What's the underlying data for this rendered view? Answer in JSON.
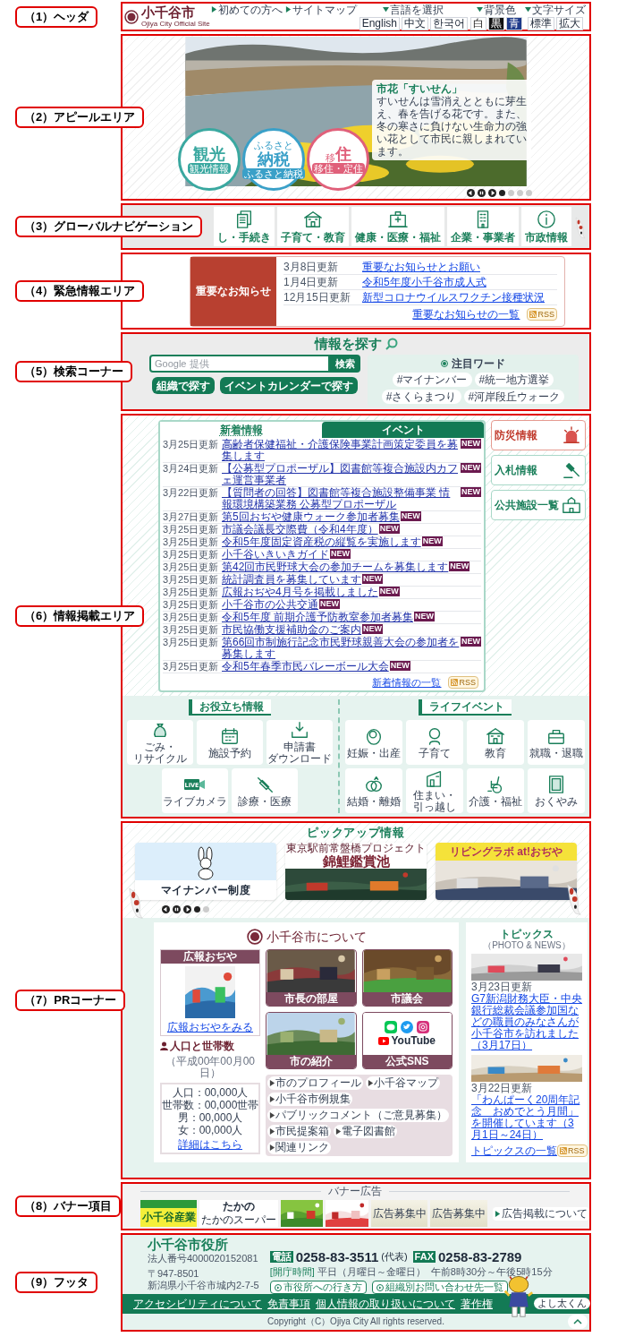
{
  "labels": [
    "（1）ヘッダ",
    "（2）アピールエリア",
    "（3）グローバルナビゲーション",
    "（4）緊急情報エリア",
    "（5）検索コーナー",
    "（6）情報掲載エリア",
    "（7）PRコーナー",
    "（8）バナー項目",
    "（9）フッタ"
  ],
  "header": {
    "logo": "小千谷市",
    "subtitle": "Ojiya City Official Site",
    "links": [
      "初めての方へ",
      "サイトマップ"
    ],
    "language": {
      "label": "言語を選択",
      "options": [
        "English",
        "中文",
        "한국어"
      ]
    },
    "background": {
      "label": "背景色",
      "options": [
        {
          "label": "白",
          "color": "#ffffff"
        },
        {
          "label": "黒",
          "color": "#111111"
        },
        {
          "label": "青",
          "color": "#1e3a8a"
        }
      ]
    },
    "font_size": {
      "label": "文字サイズ",
      "options": [
        "標準",
        "拡大"
      ]
    }
  },
  "appeal": {
    "caption_title": "市花「すいせん」",
    "caption_text": "すいせんは雪消えとともに芽生え、春を告げる花です。また、冬の寒さに負けない生命力の強い花として市民に親しまれています。",
    "badges": [
      {
        "title": "観光",
        "sub": "観光情報",
        "color": "#3aa8a0"
      },
      {
        "kicker": "ふるさと",
        "title": "納税",
        "sub": "ふるさと納税",
        "color": "#3aa0c8"
      },
      {
        "kicker": "移",
        "title": "住",
        "sub": "移住・定住",
        "color": "#e0607a"
      }
    ],
    "slides": [
      {
        "selected": true
      },
      {
        "selected": false
      },
      {
        "selected": false
      },
      {
        "selected": false
      }
    ]
  },
  "nav": {
    "items": [
      "し・手続き",
      "子育て・教育",
      "健康・医療・福祉",
      "企業・事業者",
      "市政情報"
    ]
  },
  "emergency": {
    "heading": "重要なお知らせ",
    "items": [
      {
        "date": "3月8日更新",
        "title": "重要なお知らせとお願い"
      },
      {
        "date": "1月4日更新",
        "title": "令和5年度小千谷市成人式"
      },
      {
        "date": "12月15日更新",
        "title": "新型コロナウイルスワクチン接種状況"
      }
    ],
    "more": "重要なお知らせの一覧",
    "rss": "RSS"
  },
  "search": {
    "title": "情報を探す",
    "placeholder": "Google 提供",
    "button": "検索",
    "buttons": [
      "組織で探す",
      "イベントカレンダーで探す"
    ],
    "keywords_title": "注目ワード",
    "keywords": [
      "#マイナンバー",
      "#統一地方選挙",
      "#さくらまつり",
      "#河岸段丘ウォーク"
    ]
  },
  "info": {
    "tabs": [
      {
        "label": "新着情報",
        "selected": true
      },
      {
        "label": "イベント",
        "selected": false
      }
    ],
    "news": [
      {
        "date": "3月25日更新",
        "title": "高齢者保健福祉・介護保険事業計画策定委員を募集します",
        "badge": "NEW"
      },
      {
        "date": "3月24日更新",
        "title": "【公募型プロポーザル】図書館等複合施設内カフェ運営事業者",
        "badge": "NEW"
      },
      {
        "date": "3月22日更新",
        "title": "【質問者の回答】図書館等複合施設整備事業 情報環境構築業務 公募型プロポーザル",
        "badge": "NEW"
      },
      {
        "date": "3月27日更新",
        "title": "第5回おぢや健康ウォーク参加者募集",
        "badge": "NEW"
      },
      {
        "date": "3月25日更新",
        "title": "市議会議長交際費（令和4年度）",
        "badge": "NEW"
      },
      {
        "date": "3月25日更新",
        "title": "令和5年度固定資産税の縦覧を実施します",
        "badge": "NEW"
      },
      {
        "date": "3月25日更新",
        "title": "小千谷いきいきガイド",
        "badge": "NEW"
      },
      {
        "date": "3月25日更新",
        "title": "第42回市民野球大会の参加チームを募集します",
        "badge": "NEW"
      },
      {
        "date": "3月25日更新",
        "title": "統計調査員を募集しています",
        "badge": "NEW"
      },
      {
        "date": "3月25日更新",
        "title": "広報おぢや4月号を掲載しました",
        "badge": "NEW"
      },
      {
        "date": "3月25日更新",
        "title": "小千谷市の公共交通",
        "badge": "NEW"
      },
      {
        "date": "3月25日更新",
        "title": "令和5年度 前期介護予防教室参加者募集",
        "badge": "NEW"
      },
      {
        "date": "3月25日更新",
        "title": "市民協働支援補助金のご案内",
        "badge": "NEW"
      },
      {
        "date": "3月25日更新",
        "title": "第66回市制施行記念市民野球親善大会の参加者を募集します",
        "badge": "NEW"
      },
      {
        "date": "3月25日更新",
        "title": "令和5年春季市民バレーボール大会",
        "badge": "NEW"
      }
    ],
    "more": "新着情報の一覧",
    "rss": "RSS",
    "side": [
      {
        "label": "防災情報",
        "kind": "alert"
      },
      {
        "label": "入札情報",
        "kind": "normal"
      },
      {
        "label": "公共施設一覧",
        "kind": "normal"
      }
    ],
    "useful": {
      "title": "お役立ち情報",
      "items": [
        {
          "label": [
            "ごみ・",
            "リサイクル"
          ]
        },
        {
          "label": [
            "施設予約"
          ]
        },
        {
          "label": [
            "申請書",
            "ダウンロード"
          ]
        },
        {
          "label": [
            "ライブカメラ"
          ],
          "icon_text": "LIVE"
        },
        {
          "label": [
            "診療・医療"
          ]
        }
      ]
    },
    "life": {
      "title": "ライフイベント",
      "items": [
        {
          "label": [
            "妊娠・出産"
          ]
        },
        {
          "label": [
            "子育て"
          ]
        },
        {
          "label": [
            "教育"
          ]
        },
        {
          "label": [
            "就職・退職"
          ]
        },
        {
          "label": [
            "結婚・離婚"
          ]
        },
        {
          "label": [
            "住まい・",
            "引っ越し"
          ]
        },
        {
          "label": [
            "介護・福祉"
          ]
        },
        {
          "label": [
            "おくやみ"
          ]
        }
      ]
    }
  },
  "pr": {
    "pickup_title": "ピックアップ情報",
    "pickups": [
      {
        "kind": "mascot",
        "texts": [
          "マイナンバー制度"
        ]
      },
      {
        "kind": "titled",
        "texts": [
          "東京駅前常盤橋プロジェクト",
          "錦鯉鑑賞池"
        ]
      },
      {
        "kind": "band",
        "texts": [
          "リビングラボ at!おぢや"
        ]
      }
    ],
    "slides": [
      {
        "selected": true
      },
      {
        "selected": false
      }
    ],
    "about": {
      "title": "小千谷市について",
      "magazine": {
        "title": "広報おぢや",
        "link": "広報おぢやをみる"
      },
      "population": {
        "title": "人口と世帯数",
        "date": "（平成00年00月00日）",
        "stats": [
          "人口：00,000人",
          "世帯数：00,000世帯",
          "男：00,000人",
          "女：00,000人"
        ],
        "link": "詳細はこちら"
      },
      "tiles": [
        {
          "label": "市長の部屋"
        },
        {
          "label": "市議会"
        },
        {
          "label": "市の紹介"
        },
        {
          "label": "公式SNS",
          "kind": "sns"
        }
      ],
      "sns_logo_text": "YouTube",
      "links": [
        "市のプロフィール",
        "小千谷マップ",
        "小千谷市例規集",
        "パブリックコメント（ご意見募集）",
        "市民提案箱",
        "電子図書館",
        "関連リンク"
      ]
    },
    "topics": {
      "title": "トピックス",
      "subtitle": "（PHOTO & NEWS）",
      "items": [
        {
          "date": "3月23日更新",
          "title": "G7新潟財務大臣・中央銀行総裁会議参加国などの職員のみなさんが小千谷市を訪れました（3月17日）"
        },
        {
          "date": "3月22日更新",
          "title": "「わんぱーく20周年記念　おめでとう月間」を開催しています（3月1日～24日）"
        }
      ],
      "more": "トピックスの一覧",
      "rss": "RSS"
    }
  },
  "banner": {
    "title": "バナー広告",
    "ads": [
      {
        "kind": "sangyo",
        "texts": [
          "小千谷産業"
        ]
      },
      {
        "kind": "takano",
        "texts": [
          "たかの",
          "たかのスーパー"
        ]
      },
      {
        "kind": "picture"
      },
      {
        "kind": "picture"
      },
      {
        "kind": "wanted",
        "texts": [
          "広告募集中"
        ]
      },
      {
        "kind": "wanted",
        "texts": [
          "広告募集中"
        ]
      }
    ],
    "about_link": "広告掲載について"
  },
  "footer": {
    "name": "小千谷市役所",
    "corp": "法人番号4000020152081",
    "zip": "〒947-8501",
    "address": "新潟県小千谷市城内2-7-5",
    "tel_label": "電話",
    "tel": "0258-83-3511",
    "tel_note": "(代表)",
    "fax_label": "FAX",
    "fax": "0258-83-2789",
    "hours_label": "[開庁時間]",
    "hours_days": "平日（月曜日～金曜日）",
    "hours_time": "午前8時30分～午後5時15分",
    "buttons": [
      "市役所への行き方",
      "組織別お問い合わせ先一覧"
    ],
    "links": [
      "アクセシビリティについて",
      "免責事項",
      "個人情報の取り扱いについて",
      "著作権"
    ],
    "mascot": "よし太くん",
    "copyright": "Copyright（C）Ojiya City All rights reserved."
  }
}
